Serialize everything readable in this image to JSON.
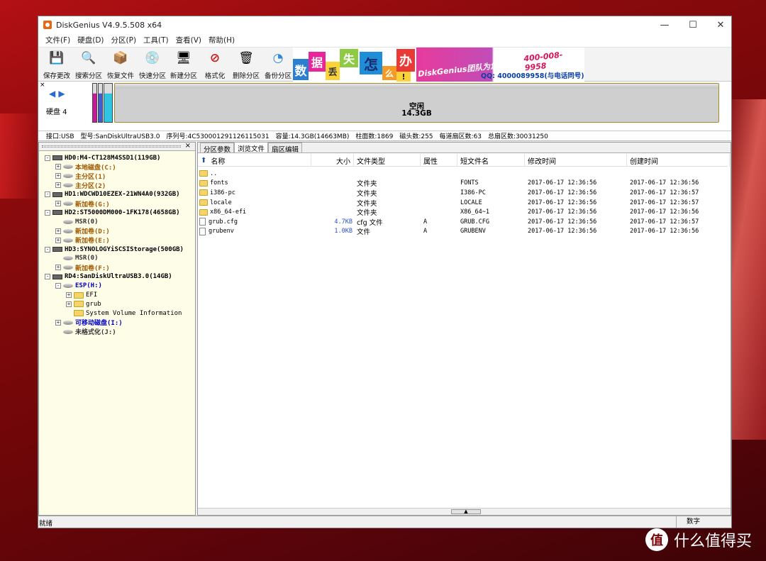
{
  "window": {
    "title": "DiskGenius V4.9.5.508 x64",
    "controls": {
      "minimize": "—",
      "maximize": "☐",
      "close": "✕"
    }
  },
  "menu": [
    "文件(F)",
    "硬盘(D)",
    "分区(P)",
    "工具(T)",
    "查看(V)",
    "帮助(H)"
  ],
  "toolbar": [
    {
      "label": "保存更改",
      "icon": "save-icon",
      "glyph": "💾"
    },
    {
      "label": "搜索分区",
      "icon": "magnifier-icon",
      "glyph": "🔍"
    },
    {
      "label": "恢复文件",
      "icon": "recover-box-icon",
      "glyph": "📦"
    },
    {
      "label": "快速分区",
      "icon": "disc-icon",
      "glyph": "💿"
    },
    {
      "label": "新建分区",
      "icon": "computer-icon",
      "glyph": "🖥"
    },
    {
      "label": "格式化",
      "icon": "format-icon",
      "glyph": "⊘"
    },
    {
      "label": "删除分区",
      "icon": "trash-icon",
      "glyph": "🗑"
    },
    {
      "label": "备份分区",
      "icon": "backup-icon",
      "glyph": "◔"
    }
  ],
  "banner": {
    "chars": [
      "数",
      "据",
      "丢",
      "失",
      "怎",
      "么",
      "办",
      "!"
    ],
    "team": "DiskGenius团队为您服务",
    "phone": "400-008-9958",
    "qq": "QQ: 4000089958(与电话同号)"
  },
  "disk_map": {
    "nav": "◀ ▶",
    "label": "硬盘 4",
    "close": "×",
    "free_name": "空闲",
    "free_size": "14.3GB",
    "partition_colors": [
      "#c8199c",
      "#3f5fd0",
      "#2fc4e2"
    ]
  },
  "disk_info": [
    "接口:USB",
    "型号:SanDiskUltraUSB3.0",
    "序列号:4C530001291126115031",
    "容量:14.3GB(14663MB)",
    "柱面数:1869",
    "磁头数:255",
    "每道扇区数:63",
    "总扇区数:30031250"
  ],
  "tree": [
    {
      "text": "HD0:M4-CT128M4SSD1(119GB)",
      "cls": "c-disk",
      "type": "hdd",
      "level": 0,
      "exp": "-"
    },
    {
      "text": "本地磁盘(C:)",
      "cls": "c-vol",
      "type": "vol",
      "level": 1,
      "exp": "+"
    },
    {
      "text": "主分区(1)",
      "cls": "c-vol",
      "type": "vol",
      "level": 1,
      "exp": "+"
    },
    {
      "text": "主分区(2)",
      "cls": "c-vol",
      "type": "vol",
      "level": 1,
      "exp": "+"
    },
    {
      "text": "HD1:WDCWD10EZEX-21WN4A0(932GB)",
      "cls": "c-disk",
      "type": "hdd",
      "level": 0,
      "exp": "-"
    },
    {
      "text": "新加卷(G:)",
      "cls": "c-vol",
      "type": "vol",
      "level": 1,
      "exp": "+"
    },
    {
      "text": "HD2:ST5000DM000-1FK178(4658GB)",
      "cls": "c-disk",
      "type": "hdd",
      "level": 0,
      "exp": "-"
    },
    {
      "text": "MSR(0)",
      "cls": "c-gray",
      "type": "vol",
      "level": 1,
      "exp": ""
    },
    {
      "text": "新加卷(D:)",
      "cls": "c-vol",
      "type": "vol",
      "level": 1,
      "exp": "+"
    },
    {
      "text": "新加卷(E:)",
      "cls": "c-vol",
      "type": "vol",
      "level": 1,
      "exp": "+"
    },
    {
      "text": "HD3:SYNOLOGYiSCSIStorage(500GB)",
      "cls": "c-disk",
      "type": "hdd",
      "level": 0,
      "exp": "-"
    },
    {
      "text": "MSR(0)",
      "cls": "c-gray",
      "type": "vol",
      "level": 1,
      "exp": ""
    },
    {
      "text": "新加卷(F:)",
      "cls": "c-vol",
      "type": "vol",
      "level": 1,
      "exp": "+"
    },
    {
      "text": "RD4:SanDiskUltraUSB3.0(14GB)",
      "cls": "c-disk",
      "type": "hdd",
      "level": 0,
      "exp": "-"
    },
    {
      "text": "ESP(H:)",
      "cls": "c-esp",
      "type": "vol",
      "level": 1,
      "exp": "-"
    },
    {
      "text": "EFI",
      "cls": "plain",
      "type": "folder",
      "level": 2,
      "exp": "+"
    },
    {
      "text": "grub",
      "cls": "plain",
      "type": "folder",
      "level": 2,
      "exp": "+"
    },
    {
      "text": "System Volume Information",
      "cls": "plain",
      "type": "folder",
      "level": 2,
      "exp": ""
    },
    {
      "text": "可移动磁盘(I:)",
      "cls": "c-esp",
      "type": "vol",
      "level": 1,
      "exp": "+"
    },
    {
      "text": "未格式化(J:)",
      "cls": "c-gray",
      "type": "vol",
      "level": 1,
      "exp": ""
    }
  ],
  "tabs": [
    "分区参数",
    "浏览文件",
    "扇区编辑"
  ],
  "active_tab": 1,
  "columns": {
    "name": "名称",
    "size": "大小",
    "type": "文件类型",
    "attr": "属性",
    "short": "短文件名",
    "modified": "修改时间",
    "created": "创建时间"
  },
  "files": [
    {
      "name": "..",
      "size": "",
      "type": "",
      "attr": "",
      "short": "",
      "modified": "",
      "created": "",
      "kind": "folder"
    },
    {
      "name": "fonts",
      "size": "",
      "type": "文件夹",
      "attr": "",
      "short": "FONTS",
      "modified": "2017-06-17 12:36:56",
      "created": "2017-06-17 12:36:56",
      "kind": "folder"
    },
    {
      "name": "i386-pc",
      "size": "",
      "type": "文件夹",
      "attr": "",
      "short": "I386-PC",
      "modified": "2017-06-17 12:36:56",
      "created": "2017-06-17 12:36:57",
      "kind": "folder"
    },
    {
      "name": "locale",
      "size": "",
      "type": "文件夹",
      "attr": "",
      "short": "LOCALE",
      "modified": "2017-06-17 12:36:56",
      "created": "2017-06-17 12:36:57",
      "kind": "folder"
    },
    {
      "name": "x86_64-efi",
      "size": "",
      "type": "文件夹",
      "attr": "",
      "short": "X86_64~1",
      "modified": "2017-06-17 12:36:56",
      "created": "2017-06-17 12:36:56",
      "kind": "folder"
    },
    {
      "name": "grub.cfg",
      "size": "4.7KB",
      "type": "cfg 文件",
      "attr": "A",
      "short": "GRUB.CFG",
      "modified": "2017-06-17 12:36:56",
      "created": "2017-06-17 12:36:57",
      "kind": "file"
    },
    {
      "name": "grubenv",
      "size": "1.0KB",
      "type": "文件",
      "attr": "A",
      "short": "GRUBENV",
      "modified": "2017-06-17 12:36:56",
      "created": "2017-06-17 12:36:56",
      "kind": "file"
    }
  ],
  "status": {
    "left": "就绪",
    "mode": "数字"
  },
  "watermark": {
    "logo": "值",
    "text": "什么值得买"
  }
}
